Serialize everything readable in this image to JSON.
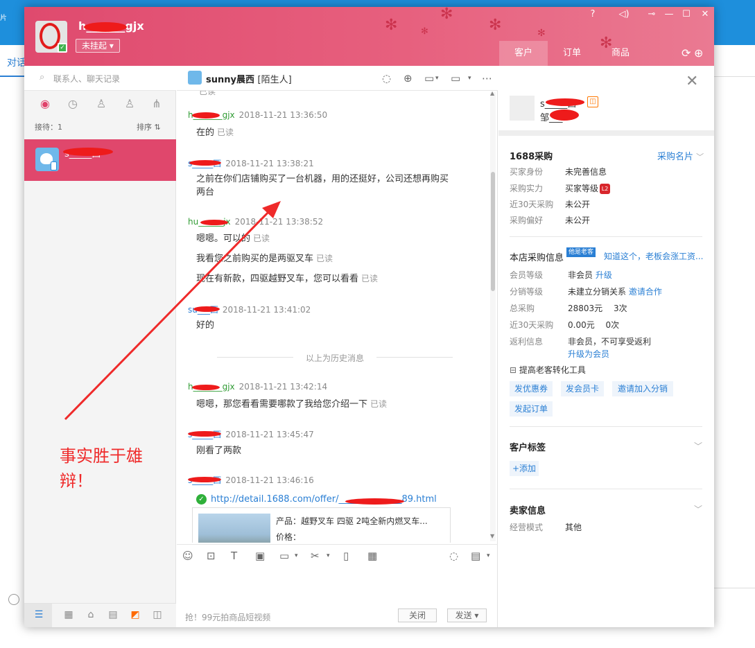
{
  "background": {
    "tab_label": "对话",
    "left_glyph": "片"
  },
  "header": {
    "username": "h_______gjx",
    "status": "未挂起",
    "tabs": [
      "客户",
      "订单",
      "商品"
    ]
  },
  "left": {
    "search_placeholder": "联系人、聊天记录",
    "reception": "接待：1",
    "sort": "排序 ⇅",
    "contact_name": "s_____西"
  },
  "chat": {
    "name": "sunny晨西",
    "tag": "[陌生人]",
    "top_read": "已读",
    "messages": [
      {
        "sender": "h_______gjx",
        "side": "me",
        "time": "2018-11-21 13:36:50",
        "lines": [
          {
            "text": "在的",
            "read": "已读"
          }
        ]
      },
      {
        "sender": "s_____西",
        "side": "them",
        "time": "2018-11-21 13:38:21",
        "lines": [
          {
            "text": "之前在你们店铺购买了一台机器，用的还挺好，公司还想再购买两台",
            "read": ""
          }
        ]
      },
      {
        "sender": "hu______jx",
        "side": "me",
        "time": "2018-11-21 13:38:52",
        "lines": [
          {
            "text": "嗯嗯。可以的",
            "read": "已读"
          },
          {
            "text": "我看您之前购买的是两驱叉车",
            "read": "已读"
          },
          {
            "text": "现在有新款，四驱越野叉车，您可以看看",
            "read": "已读"
          }
        ]
      },
      {
        "sender": "su___西",
        "side": "them",
        "time": "2018-11-21 13:41:02",
        "lines": [
          {
            "text": "好的",
            "read": ""
          }
        ]
      }
    ],
    "divider": "以上为历史消息",
    "messages2": [
      {
        "sender": "h_______gjx",
        "side": "me",
        "time": "2018-11-21 13:42:14",
        "lines": [
          {
            "text": "嗯嗯，那您看看需要哪款了我给您介绍一下",
            "read": "已读"
          }
        ]
      },
      {
        "sender": "s_____西",
        "side": "them",
        "time": "2018-11-21 13:45:47",
        "lines": [
          {
            "text": "刚看了两款",
            "read": ""
          }
        ]
      },
      {
        "sender": "s_____西",
        "side": "them",
        "time": "2018-11-21 13:46:16",
        "lines": []
      }
    ],
    "link": "http://detail.1688.com/offer/______________89.html",
    "card": {
      "product": "产品：越野叉车 四驱 2吨全新内燃叉车...",
      "price": "价格："
    },
    "promo": "抢！99元拍商品短视频",
    "close_btn": "关闭",
    "send_btn": "发送"
  },
  "right": {
    "name": "s_____西",
    "sub": "邹___",
    "section1": {
      "title": "1688采购",
      "link": "采购名片",
      "rows": [
        {
          "label": "买家身份",
          "value": "未完善信息"
        },
        {
          "label": "采购实力",
          "value": "买家等级"
        },
        {
          "label": "近30天采购",
          "value": "未公开"
        },
        {
          "label": "采购偏好",
          "value": "未公开"
        }
      ],
      "level_badge": "L2"
    },
    "section2": {
      "title": "本店采购信息",
      "chip": "他是老客",
      "link": "知道这个，老板会涨工资...",
      "rows": [
        {
          "label": "会员等级",
          "value": "非会员",
          "action": "升级"
        },
        {
          "label": "分销等级",
          "value": "未建立分销关系",
          "action": "邀请合作"
        },
        {
          "label": "总采购",
          "value": "28803元　 3次",
          "action": ""
        },
        {
          "label": "近30天采购",
          "value": "0.00元　 0次",
          "action": ""
        },
        {
          "label": "返利信息",
          "value": "非会员，不可享受返利",
          "action": ""
        }
      ],
      "upgrade_link": "升级为会员",
      "tools_title": "提高老客转化工具",
      "buttons": [
        "发优惠券",
        "发会员卡",
        "邀请加入分销",
        "发起订单"
      ]
    },
    "section3": {
      "title": "客户标签",
      "add": "+添加"
    },
    "section4": {
      "title": "卖家信息",
      "label": "经营模式",
      "value": "其他"
    }
  },
  "annotation": {
    "line1": "事实胜于雄",
    "line2": "辩！",
    "color": "#ef2a2a"
  },
  "colors": {
    "header_pink": "#e25575",
    "selected_contact": "#e0476c",
    "link_blue": "#2a7fd4",
    "me_green": "#2f9b33"
  }
}
